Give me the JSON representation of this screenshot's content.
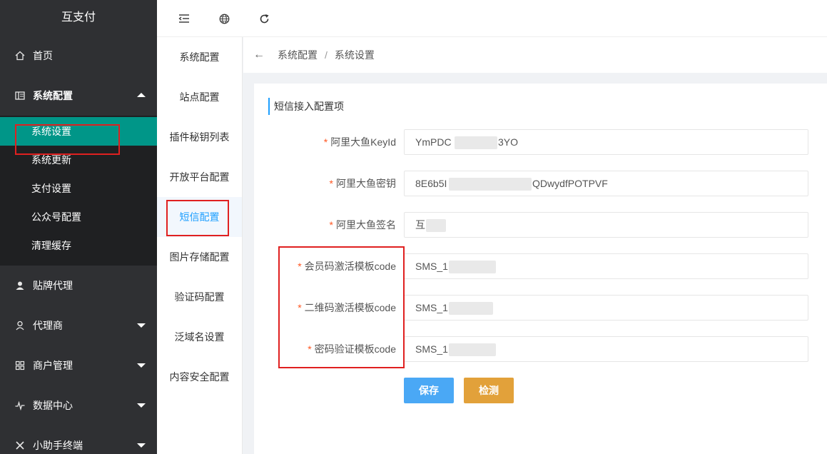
{
  "app": {
    "brand": "互支付"
  },
  "sidebar": {
    "items": [
      {
        "label": "首页",
        "icon": "home-icon"
      },
      {
        "label": "系统配置",
        "icon": "settings-grid-icon"
      },
      {
        "label": "贴牌代理",
        "icon": "user-icon"
      },
      {
        "label": "代理商",
        "icon": "person-icon"
      },
      {
        "label": "商户管理",
        "icon": "grid-icon"
      },
      {
        "label": "数据中心",
        "icon": "pulse-icon"
      },
      {
        "label": "小助手终端",
        "icon": "tool-icon"
      }
    ],
    "submenu": [
      "系统设置",
      "系统更新",
      "支付设置",
      "公众号配置",
      "清理缓存"
    ]
  },
  "topbar": {
    "icons": [
      "menu-collapse-icon",
      "globe-icon",
      "refresh-icon"
    ]
  },
  "config_menu": {
    "items": [
      "系统配置",
      "站点配置",
      "插件秘钥列表",
      "开放平台配置",
      "短信配置",
      "图片存储配置",
      "验证码配置",
      "泛域名设置",
      "内容安全配置"
    ]
  },
  "breadcrumb": {
    "level1": "系统配置",
    "separator": "/",
    "level2": "系统设置"
  },
  "form": {
    "section_title": "短信接入配置项",
    "required_mark": "*",
    "fields": [
      {
        "label": "阿里大鱼KeyId",
        "value": "YmPDC",
        "value_tail": "3YO"
      },
      {
        "label": "阿里大鱼密钥",
        "value": "8E6b5I",
        "value_tail": "QDwydfPOTPVF"
      },
      {
        "label": "阿里大鱼签名",
        "value": "互",
        "value_tail": ""
      },
      {
        "label": "会员码激活模板code",
        "value": "SMS_1",
        "value_tail": ""
      },
      {
        "label": "二维码激活模板code",
        "value": "SMS_1",
        "value_tail": ""
      },
      {
        "label": "密码验证模板code",
        "value": "SMS_1",
        "value_tail": ""
      }
    ],
    "save_label": "保存",
    "check_label": "检测"
  },
  "colors": {
    "accent": "#1e9fff",
    "active_sub": "#009688",
    "highlight": "#e02020",
    "save": "#4aa8f5",
    "check": "#e2a13a"
  }
}
